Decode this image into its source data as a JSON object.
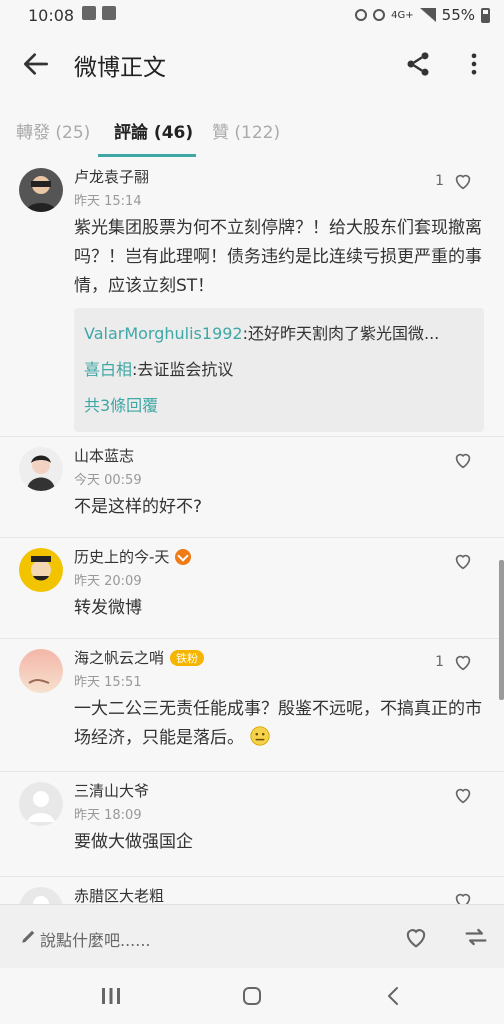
{
  "status": {
    "time": "10:08",
    "battery_text": "55%",
    "network": "4G+"
  },
  "header": {
    "title": "微博正文"
  },
  "tabs": [
    {
      "label": "轉發 (25)"
    },
    {
      "label": "評論 (46)"
    },
    {
      "label": "贊 (122)"
    }
  ],
  "comments": [
    {
      "user": "卢龙袁子翮",
      "time": "昨天 15:14",
      "likes": "1",
      "text": "紫光集团股票为何不立刻停牌？！给大股东们套现撤离吗？！岂有此理啊！债务违约是比连续亏损更严重的事情，应该立刻ST！",
      "replies": [
        {
          "user": "ValarMorghulis1992",
          "text": ":还好昨天割肉了紫光国微..."
        },
        {
          "user": "喜白相",
          "text": ":去证监会抗议"
        }
      ],
      "more_replies": "共3條回覆"
    },
    {
      "user": "山本蓝志",
      "time": "今天 00:59",
      "likes": "",
      "text": "不是这样的好不?"
    },
    {
      "user": "历史上的今-天",
      "time": "昨天 20:09",
      "likes": "",
      "text": "转发微博"
    },
    {
      "user": "海之帆云之哨",
      "badge": "铁粉",
      "time": "昨天 15:51",
      "likes": "1",
      "text": "一大二公三无责任能成事？殷鉴不远呢，不搞真正的市场经济，只能是落后。"
    },
    {
      "user": "三清山大爷",
      "time": "昨天 18:09",
      "likes": "",
      "text": "要做大做强国企"
    },
    {
      "user": "赤腊区大老粗",
      "time": "",
      "likes": "",
      "text": ""
    }
  ],
  "bottom_bar": {
    "placeholder": "說點什麼吧......"
  },
  "colors": {
    "accent": "#3fa7a6",
    "badge_orange": "#f07a13",
    "fan_badge": "#f5b400"
  }
}
